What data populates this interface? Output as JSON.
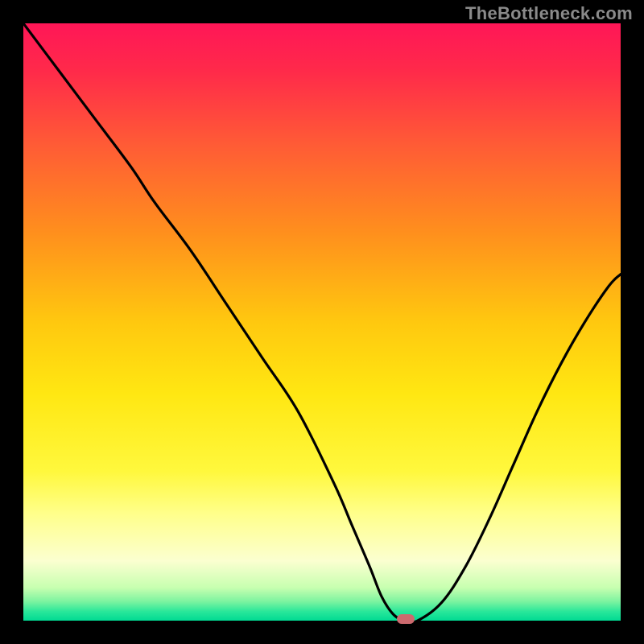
{
  "watermark": "TheBottleneck.com",
  "colors": {
    "border": "#000000",
    "curve": "#000000",
    "marker": "#cc6a6e",
    "gradient_stops": [
      {
        "offset": 0.0,
        "color": "#ff1657"
      },
      {
        "offset": 0.08,
        "color": "#ff2a4a"
      },
      {
        "offset": 0.2,
        "color": "#ff5a36"
      },
      {
        "offset": 0.35,
        "color": "#ff8f1d"
      },
      {
        "offset": 0.5,
        "color": "#ffc80f"
      },
      {
        "offset": 0.62,
        "color": "#ffe712"
      },
      {
        "offset": 0.75,
        "color": "#fff83d"
      },
      {
        "offset": 0.82,
        "color": "#ffff8a"
      },
      {
        "offset": 0.9,
        "color": "#fbffd0"
      },
      {
        "offset": 0.945,
        "color": "#c7ffb0"
      },
      {
        "offset": 0.968,
        "color": "#7cf3a0"
      },
      {
        "offset": 0.985,
        "color": "#28e79a"
      },
      {
        "offset": 1.0,
        "color": "#00da93"
      }
    ]
  },
  "chart_data": {
    "type": "line",
    "title": "",
    "xlabel": "",
    "ylabel": "",
    "xlim": [
      0,
      100
    ],
    "ylim": [
      0,
      100
    ],
    "series": [
      {
        "name": "bottleneck-curve",
        "x": [
          0,
          6,
          12,
          18,
          22,
          28,
          34,
          40,
          46,
          52,
          55,
          58,
          60,
          62,
          64,
          66,
          70,
          74,
          78,
          82,
          86,
          90,
          94,
          98,
          100
        ],
        "y": [
          100,
          92,
          84,
          76,
          70,
          62,
          53,
          44,
          35,
          23,
          16,
          9,
          4,
          1,
          0,
          0,
          3,
          9,
          17,
          26,
          35,
          43,
          50,
          56,
          58
        ]
      }
    ],
    "marker": {
      "x": 64,
      "y": 0
    },
    "description": "V-shaped bottleneck curve over red-to-green vertical gradient; minimum (optimal balance) near x≈64%."
  },
  "layout": {
    "image_size": 800,
    "plot_inset": 29,
    "plot_size": 742
  }
}
